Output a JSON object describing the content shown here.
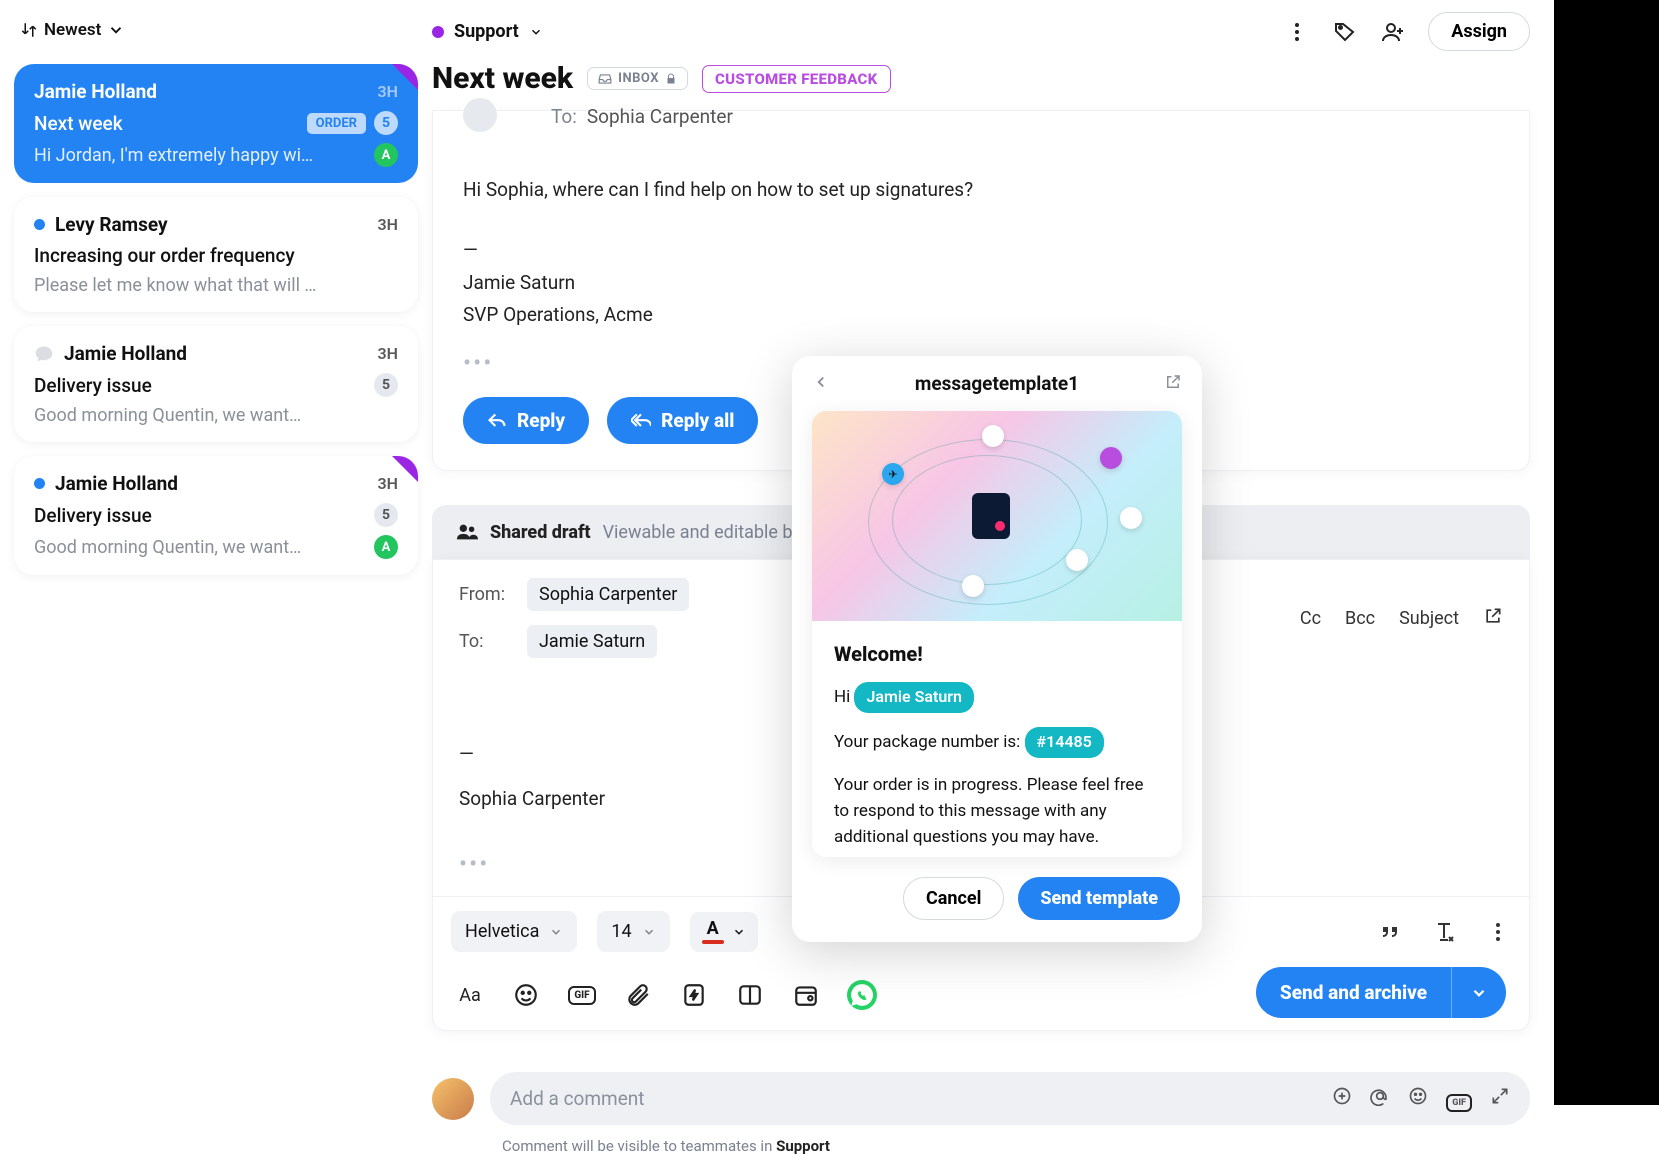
{
  "sort": {
    "label": "Newest"
  },
  "conversations": [
    {
      "sender": "Jamie Holland",
      "time": "3H",
      "subject": "Next week",
      "order_tag": "ORDER",
      "count": "5",
      "preview": "Hi Jordan, I'm extremely happy wi…",
      "avatar": "A",
      "active": true,
      "corner": true,
      "unread": false,
      "chat": false
    },
    {
      "sender": "Levy Ramsey",
      "time": "3H",
      "subject": "Increasing our order frequency",
      "preview": "Please let me know what that will …",
      "unread": true
    },
    {
      "sender": "Jamie Holland",
      "time": "3H",
      "subject": "Delivery issue",
      "count": "5",
      "preview": "Good morning Quentin, we want…",
      "chat": true
    },
    {
      "sender": "Jamie Holland",
      "time": "3H",
      "subject": "Delivery issue",
      "count": "5",
      "preview": "Good morning Quentin, we want…",
      "avatar": "A",
      "unread": true,
      "corner": true
    }
  ],
  "topbar": {
    "channel": "Support",
    "assign": "Assign"
  },
  "thread": {
    "title": "Next week",
    "inbox_label": "INBOX",
    "feedback_label": "CUSTOMER FEEDBACK",
    "to_label": "To:",
    "to_name": "Sophia Carpenter",
    "body_greeting": "Hi Sophia, where can I find help on how to set up signatures?",
    "sig_name": "Jamie Saturn",
    "sig_title": "SVP Operations, Acme",
    "reply": "Reply",
    "reply_all": "Reply all"
  },
  "compose": {
    "shared_label": "Shared draft",
    "shared_sub": "Viewable and editable by",
    "from_label": "From:",
    "from_value": "Sophia Carpenter",
    "to_label": "To:",
    "to_value": "Jamie Saturn",
    "cc": "Cc",
    "bcc": "Bcc",
    "subject": "Subject",
    "signature": "Sophia Carpenter",
    "font": "Helvetica",
    "size": "14",
    "send": "Send and archive"
  },
  "template": {
    "name": "messagetemplate1",
    "welcome": "Welcome!",
    "hi": "Hi",
    "recipient": "Jamie Saturn",
    "pkg_label": "Your package number is:",
    "pkg_value": "#14485",
    "body": "Your order is in progress. Please feel free to respond to this message with any additional questions you may have.",
    "cancel": "Cancel",
    "send": "Send template"
  },
  "comment": {
    "placeholder": "Add a comment",
    "note_prefix": "Comment will be visible to teammates in ",
    "note_bold": "Support"
  }
}
